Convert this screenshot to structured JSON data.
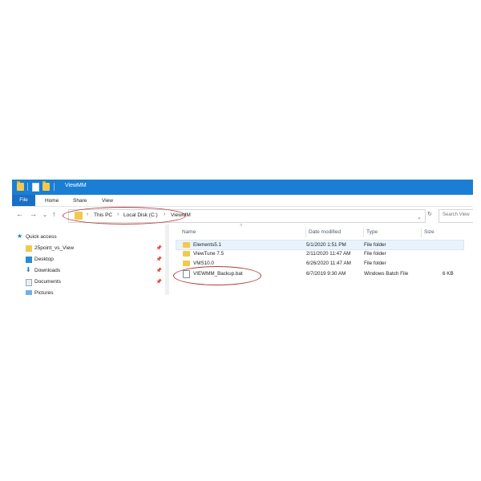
{
  "window": {
    "title": "ViewMM"
  },
  "ribbon": {
    "tabs": [
      "File",
      "Home",
      "Share",
      "View"
    ]
  },
  "address": {
    "crumbs": [
      "This PC",
      "Local Disk (C:)",
      "ViewMM"
    ],
    "search_placeholder": "Search View"
  },
  "nav_pane": {
    "items": [
      {
        "label": "Quick access",
        "icon": "star-icon",
        "pinned": false
      },
      {
        "label": "25point_vs_View",
        "icon": "folder-icon",
        "pinned": true
      },
      {
        "label": "Desktop",
        "icon": "desktop-icon",
        "pinned": true
      },
      {
        "label": "Downloads",
        "icon": "download-icon",
        "pinned": true
      },
      {
        "label": "Documents",
        "icon": "document-icon",
        "pinned": true
      },
      {
        "label": "Pictures",
        "icon": "picture-icon",
        "pinned": false
      }
    ]
  },
  "columns": [
    "Name",
    "Date modified",
    "Type",
    "Size"
  ],
  "files": [
    {
      "name": "Elements5.1",
      "date": "5/1/2020 1:51 PM",
      "type": "File folder",
      "size": "",
      "icon": "folder-icon"
    },
    {
      "name": "ViewTune 7.5",
      "date": "2/11/2020 11:47 AM",
      "type": "File folder",
      "size": "",
      "icon": "folder-icon"
    },
    {
      "name": "VMS10.0",
      "date": "6/26/2020 11:47 AM",
      "type": "File folder",
      "size": "",
      "icon": "folder-icon"
    },
    {
      "name": "VIEWMM_Backup.bat",
      "date": "6/7/2019 9:30 AM",
      "type": "Windows Batch File",
      "size": "6 KB",
      "icon": "batch-file-icon"
    }
  ],
  "colors": {
    "titlebar": "#1a7fd4",
    "file_tab": "#1a6fc4",
    "annotation_oval": "#b23a3a",
    "folder": "#f2c94c"
  }
}
